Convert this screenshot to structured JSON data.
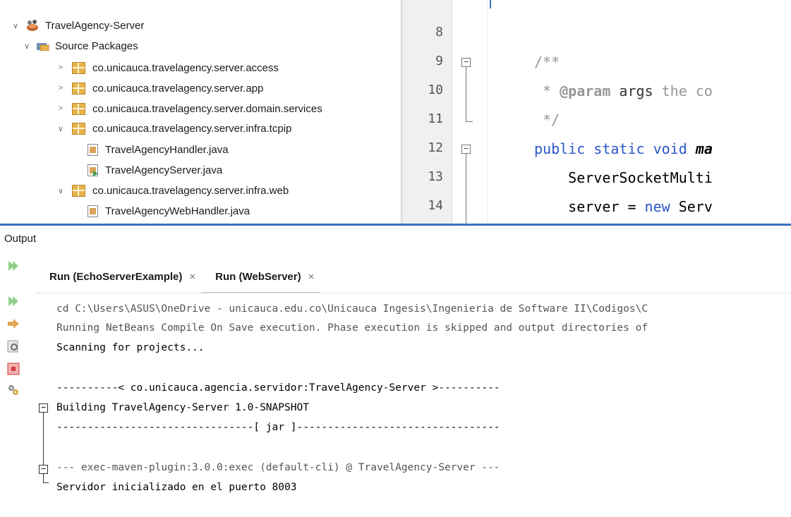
{
  "project_tree": {
    "project": "TravelAgency-Server",
    "source_folder": "Source Packages",
    "items": [
      {
        "label": "co.unicauca.travelagency.server.access",
        "type": "package",
        "expanded": false
      },
      {
        "label": "co.unicauca.travelagency.server.app",
        "type": "package",
        "expanded": false
      },
      {
        "label": "co.unicauca.travelagency.server.domain.services",
        "type": "package",
        "expanded": false
      },
      {
        "label": "co.unicauca.travelagency.server.infra.tcpip",
        "type": "package",
        "expanded": true
      },
      {
        "label": "TravelAgencyHandler.java",
        "type": "file"
      },
      {
        "label": "TravelAgencyServer.java",
        "type": "file-main"
      },
      {
        "label": "co.unicauca.travelagency.server.infra.web",
        "type": "package",
        "expanded": true
      },
      {
        "label": "TravelAgencyWebHandler.java",
        "type": "file"
      }
    ]
  },
  "editor": {
    "line_numbers": [
      "8",
      "9",
      "10",
      "11",
      "12",
      "13",
      "14"
    ],
    "lines": [
      {
        "parts": []
      },
      {
        "parts": [
          {
            "t": "/**",
            "c": "#969696"
          }
        ]
      },
      {
        "parts": [
          {
            "t": " * ",
            "c": "#969696"
          },
          {
            "t": "@param",
            "c": "#969696",
            "b": true
          },
          {
            "t": " args",
            "c": "#333333"
          },
          {
            "t": " the co",
            "c": "#969696"
          }
        ]
      },
      {
        "parts": [
          {
            "t": " */",
            "c": "#969696"
          }
        ]
      },
      {
        "parts": [
          {
            "t": "public static void ",
            "c": "#2a56c6"
          },
          {
            "t": "ma",
            "c": "#000000",
            "b": true,
            "i": true
          }
        ]
      },
      {
        "parts": [
          {
            "t": "    ServerSocketMulti",
            "c": "#000000"
          }
        ]
      },
      {
        "parts": [
          {
            "t": "    server = ",
            "c": "#000000"
          },
          {
            "t": "new",
            "c": "#2a56c6"
          },
          {
            "t": " Serv",
            "c": "#000000"
          }
        ]
      }
    ]
  },
  "output": {
    "title": "Output",
    "tabs": [
      {
        "label": "Run (EchoServerExample)",
        "close": "×"
      },
      {
        "label": "Run (WebServer)",
        "close": "×"
      }
    ],
    "lines": [
      {
        "text": "cd C:\\Users\\ASUS\\OneDrive - unicauca.edu.co\\Unicauca Ingesis\\Ingenieria de Software II\\Codigos\\C",
        "color": "#555555"
      },
      {
        "text": "Running NetBeans Compile On Save execution. Phase execution is skipped and output directories of",
        "color": "#555555"
      },
      {
        "text": "Scanning for projects...",
        "color": "#000000"
      },
      {
        "text": "",
        "color": "#000000"
      },
      {
        "text": "----------< co.unicauca.agencia.servidor:TravelAgency-Server >----------",
        "color": "#000000"
      },
      {
        "text": "Building TravelAgency-Server 1.0-SNAPSHOT",
        "color": "#000000"
      },
      {
        "text": "--------------------------------[ jar ]---------------------------------",
        "color": "#000000"
      },
      {
        "text": "",
        "color": "#000000"
      },
      {
        "text": "--- exec-maven-plugin:3.0.0:exec (default-cli) @ TravelAgency-Server ---",
        "color": "#555555"
      },
      {
        "text": "Servidor inicializado en el puerto 8003",
        "color": "#000000"
      }
    ]
  }
}
